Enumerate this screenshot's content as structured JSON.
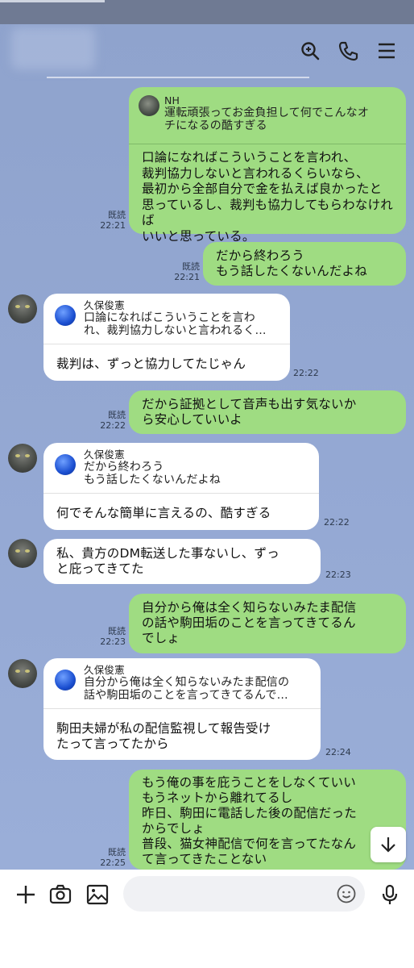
{
  "header": {
    "icons": [
      "search-icon",
      "phone-icon",
      "menu-icon"
    ]
  },
  "messages": [
    {
      "id": "m1",
      "direction": "outgoing",
      "reply": {
        "name": "NH",
        "text": "運転頑張ってお金負担して何でこんなオ\nチになるの酷すぎる",
        "avatar": "photo"
      },
      "text": "口論になればこういうことを言われ、\n裁判協力しないと言われるくらいなら、\n最初から全部自分で金を払えば良かったと\n思っているし、裁判も協力してもらわなければ\nいいと思っている。",
      "read": "既読",
      "time": "22:21"
    },
    {
      "id": "m2",
      "direction": "outgoing",
      "text": "だから終わろう\nもう話したくないんだよね",
      "read": "既読",
      "time": "22:21"
    },
    {
      "id": "m3",
      "direction": "incoming",
      "reply": {
        "name": "久保俊憲",
        "text": "口論になればこういうことを言わ\nれ、裁判協力しないと言われるく…",
        "avatar": "globe"
      },
      "text": "裁判は、ずっと協力してたじゃん",
      "time": "22:22"
    },
    {
      "id": "m4",
      "direction": "outgoing",
      "text": "だから証拠として音声も出す気ないか\nら安心していいよ",
      "read": "既読",
      "time": "22:22"
    },
    {
      "id": "m5",
      "direction": "incoming",
      "reply": {
        "name": "久保俊憲",
        "text": "だから終わろう\nもう話したくないんだよね",
        "avatar": "globe"
      },
      "text": "何でそんな簡単に言えるの、酷すぎる",
      "time": "22:22"
    },
    {
      "id": "m6",
      "direction": "incoming",
      "text": "私、貴方のDM転送した事ないし、ずっ\nと庇ってきてた",
      "time": "22:23"
    },
    {
      "id": "m7",
      "direction": "outgoing",
      "text": "自分から俺は全く知らないみたま配信\nの話や駒田垢のことを言ってきてるん\nでしょ",
      "read": "既読",
      "time": "22:23"
    },
    {
      "id": "m8",
      "direction": "incoming",
      "reply": {
        "name": "久保俊憲",
        "text": "自分から俺は全く知らないみたま配信の\n話や駒田垢のことを言ってきてるんで…",
        "avatar": "globe"
      },
      "text": "駒田夫婦が私の配信監視して報告受け\nたって言ってたから",
      "time": "22:24"
    },
    {
      "id": "m9",
      "direction": "outgoing",
      "text": "もう俺の事を庇うことをしなくていい\nもうネットから離れてるし\n昨日、駒田に電話した後の配信だった\nからでしょ\n普段、猫女神配信で何を言ってたなん\nて言ってきたことない",
      "read": "既読",
      "time": "22:25"
    }
  ],
  "input_bar": {
    "placeholder": "",
    "icons": [
      "plus-icon",
      "camera-icon",
      "image-icon",
      "emoji-icon",
      "mic-icon"
    ]
  },
  "colors": {
    "chat_bg": "#93a7d1",
    "outgoing_bubble": "#9fdc82",
    "incoming_bubble": "#ffffff"
  }
}
